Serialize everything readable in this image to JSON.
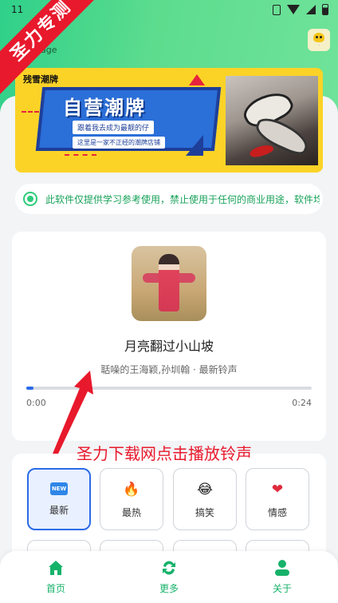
{
  "status_bar": {
    "time": "11",
    "icons": [
      "vibrate-icon",
      "wifi-icon",
      "signal-icon",
      "battery-icon"
    ]
  },
  "watermark": {
    "ribbon_text": "圣力专测"
  },
  "header": {
    "subtitle": "page"
  },
  "banner": {
    "kicker": "残雪潮牌",
    "title": "自营潮牌",
    "line1": "跟着我去成为最靓的仔",
    "line2": "这里是一家不正经的潮牌店铺"
  },
  "notice": {
    "text": "此软件仅提供学习参考使用，禁止使用于任何的商业用途，软件均来"
  },
  "player": {
    "song_title": "月亮翻过小山坡",
    "song_meta": "聒噪的王海颖,孙圳翰 · 最新铃声",
    "time_current": "0:00",
    "time_total": "0:24",
    "progress_fraction": 0.025,
    "accent_color": "#2a6be8"
  },
  "overlay": {
    "caption": "圣力下载网点击播放铃声",
    "color": "#e8192c"
  },
  "categories": [
    {
      "label": "最新",
      "icon": "new-badge-icon",
      "glyph": "NEW",
      "active": true
    },
    {
      "label": "最热",
      "icon": "fire-icon",
      "glyph": "🔥",
      "active": false
    },
    {
      "label": "搞笑",
      "icon": "laughing-face-icon",
      "glyph": "😂",
      "active": false
    },
    {
      "label": "情感",
      "icon": "heart-icon",
      "glyph": "❤",
      "active": false
    }
  ],
  "bottom_nav": {
    "items": [
      {
        "label": "首页",
        "icon": "home-icon"
      },
      {
        "label": "更多",
        "icon": "refresh-icon"
      },
      {
        "label": "关于",
        "icon": "user-icon"
      }
    ],
    "color": "#17b26a"
  }
}
